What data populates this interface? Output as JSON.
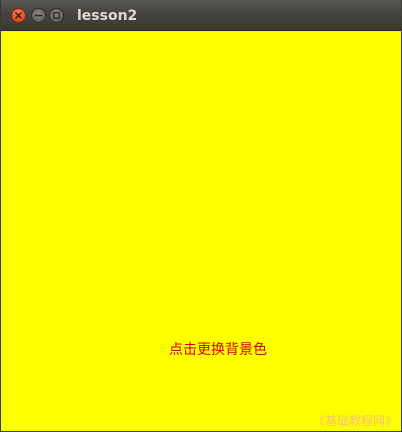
{
  "window": {
    "title": "lesson2",
    "background_color": "#ffff00"
  },
  "titlebar_buttons": {
    "close_icon": "close-icon",
    "minimize_icon": "minimize-icon",
    "maximize_icon": "maximize-icon"
  },
  "content": {
    "action_text": "点击更换背景色",
    "action_text_color": "#d60000"
  },
  "watermark": {
    "text": "《基础教程网》"
  }
}
